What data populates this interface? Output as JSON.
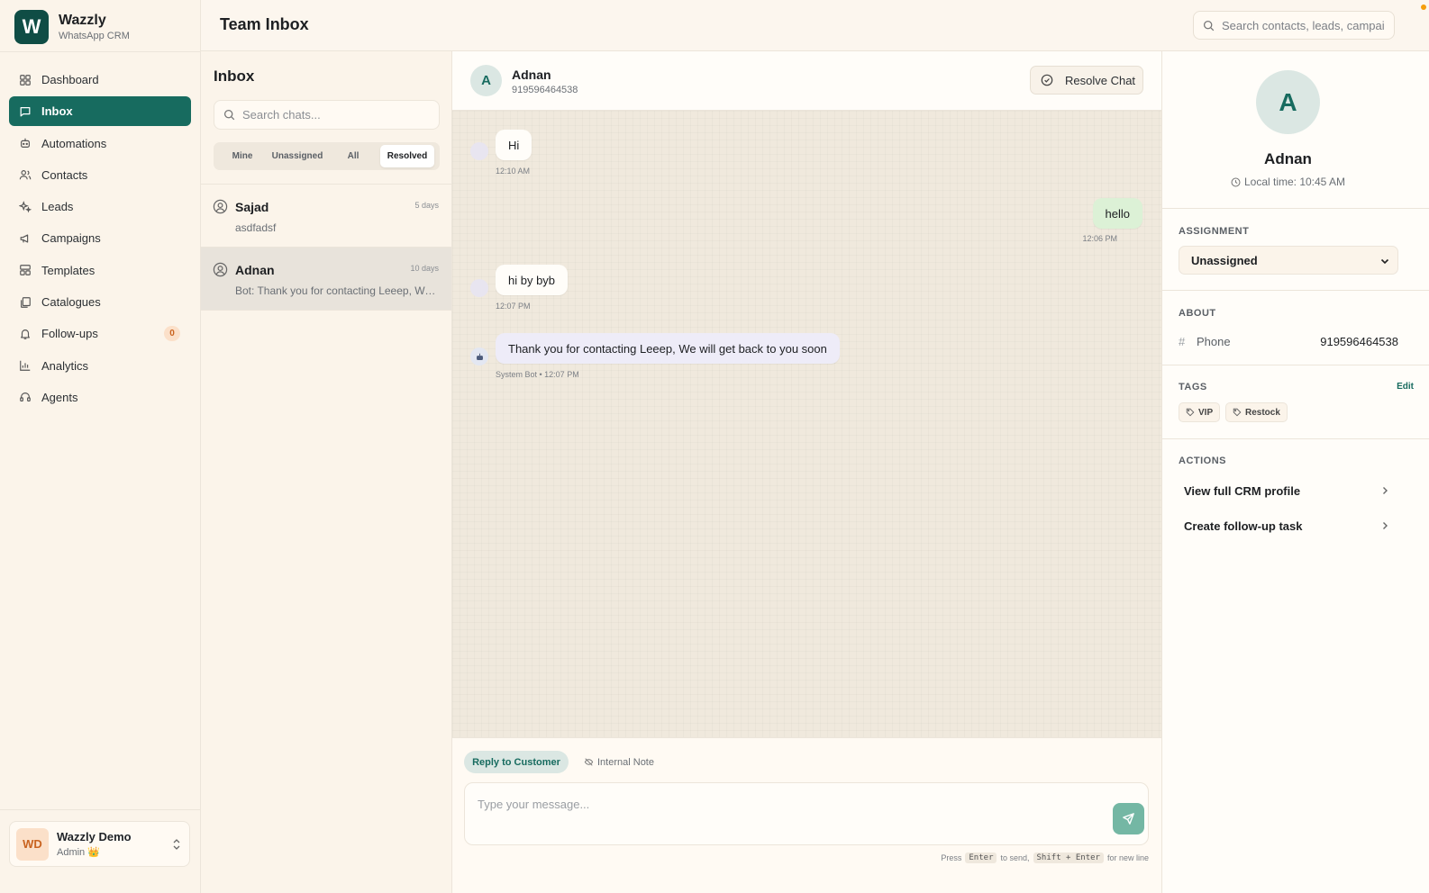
{
  "brand": {
    "logo_letter": "W",
    "name": "Wazzly",
    "subtitle": "WhatsApp CRM"
  },
  "nav": [
    {
      "label": "Dashboard",
      "icon": "grid-icon",
      "active": false
    },
    {
      "label": "Inbox",
      "icon": "message-square-icon",
      "active": true
    },
    {
      "label": "Automations",
      "icon": "bot-icon",
      "active": false
    },
    {
      "label": "Contacts",
      "icon": "users-icon",
      "active": false
    },
    {
      "label": "Leads",
      "icon": "sparkles-icon",
      "active": false
    },
    {
      "label": "Campaigns",
      "icon": "megaphone-icon",
      "active": false
    },
    {
      "label": "Templates",
      "icon": "layout-template-icon",
      "active": false
    },
    {
      "label": "Catalogues",
      "icon": "book-copy-icon",
      "active": false
    },
    {
      "label": "Follow-ups",
      "icon": "bell-icon",
      "active": false,
      "badge": "0"
    },
    {
      "label": "Analytics",
      "icon": "bar-chart-icon",
      "active": false
    },
    {
      "label": "Agents",
      "icon": "headset-icon",
      "active": false
    }
  ],
  "user": {
    "initials": "WD",
    "name": "Wazzly Demo",
    "role": "Admin 👑"
  },
  "header": {
    "title": "Team Inbox",
    "search_placeholder": "Search contacts, leads, campaigns..."
  },
  "inbox": {
    "title": "Inbox",
    "search_placeholder": "Search chats...",
    "filters": [
      {
        "label": "Mine",
        "active": false
      },
      {
        "label": "Unassigned",
        "active": false
      },
      {
        "label": "All",
        "active": false
      },
      {
        "label": "Resolved",
        "active": true
      }
    ],
    "chats": [
      {
        "name": "Sajad",
        "time": "5 days",
        "preview": "asdfadsf",
        "selected": false
      },
      {
        "name": "Adnan",
        "time": "10 days",
        "preview": "Bot: Thank you for contacting Leeep, We will get back to you soon",
        "selected": true
      }
    ]
  },
  "conversation": {
    "avatar_letter": "A",
    "name": "Adnan",
    "phone": "919596464538",
    "resolve_label": "Resolve Chat",
    "messages": [
      {
        "text": "Hi",
        "time": "12:10 AM",
        "direction": "in"
      },
      {
        "text": "hello",
        "time": "12:06 PM",
        "direction": "out"
      },
      {
        "text": "hi by byb",
        "time": "12:07 PM",
        "direction": "in"
      },
      {
        "text": "Thank you for contacting Leeep, We will get back to you soon",
        "time": "System Bot • 12:07 PM",
        "direction": "bot"
      }
    ],
    "composer": {
      "reply_label": "Reply to Customer",
      "note_label": "Internal Note",
      "placeholder": "Type your message...",
      "hint_press": "Press",
      "hint_enter": "Enter",
      "hint_to_send": "to send,",
      "hint_shift_enter": "Shift + Enter",
      "hint_new_line": "for new line"
    }
  },
  "details": {
    "avatar_letter": "A",
    "name": "Adnan",
    "local_time": "Local time: 10:45 AM",
    "assignment_title": "ASSIGNMENT",
    "assignment_value": "Unassigned",
    "about_title": "ABOUT",
    "phone_label": "Phone",
    "phone_value": "919596464538",
    "tags_title": "TAGS",
    "tags_edit": "Edit",
    "tags": [
      "VIP",
      "Restock"
    ],
    "actions_title": "ACTIONS",
    "actions": [
      "View full CRM profile",
      "Create follow-up task"
    ]
  },
  "colors": {
    "accent": "#176b5f",
    "brand_dark": "#0f4d45",
    "badge_bg": "#fbe0c9",
    "badge_fg": "#c9631f",
    "out_bubble": "#dcf1d6",
    "bot_bubble": "#eeecf8"
  }
}
